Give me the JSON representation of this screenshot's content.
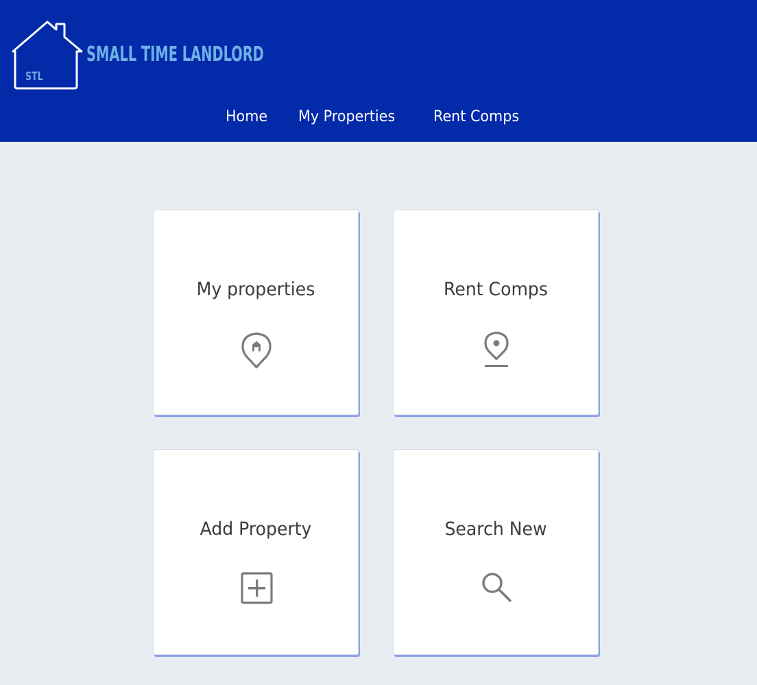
{
  "app": {
    "logo_initials": "STL",
    "logo_text": "SMALL TIME LANDLORD"
  },
  "nav": {
    "items": [
      {
        "label": "Home"
      },
      {
        "label": "My Properties"
      },
      {
        "label": "Rent Comps"
      }
    ]
  },
  "cards": [
    {
      "title": "My properties",
      "icon": "home-pin-icon"
    },
    {
      "title": "Rent Comps",
      "icon": "location-pin-icon"
    },
    {
      "title": "Add Property",
      "icon": "add-box-icon"
    },
    {
      "title": "Search New",
      "icon": "search-icon"
    }
  ],
  "colors": {
    "header_bg": "#032aa9",
    "page_bg": "#e8edf1",
    "logo_text": "#6fb0e6",
    "card_bg": "#ffffff",
    "card_shadow": "#8ea4e6",
    "icon": "#7c7c7c"
  }
}
